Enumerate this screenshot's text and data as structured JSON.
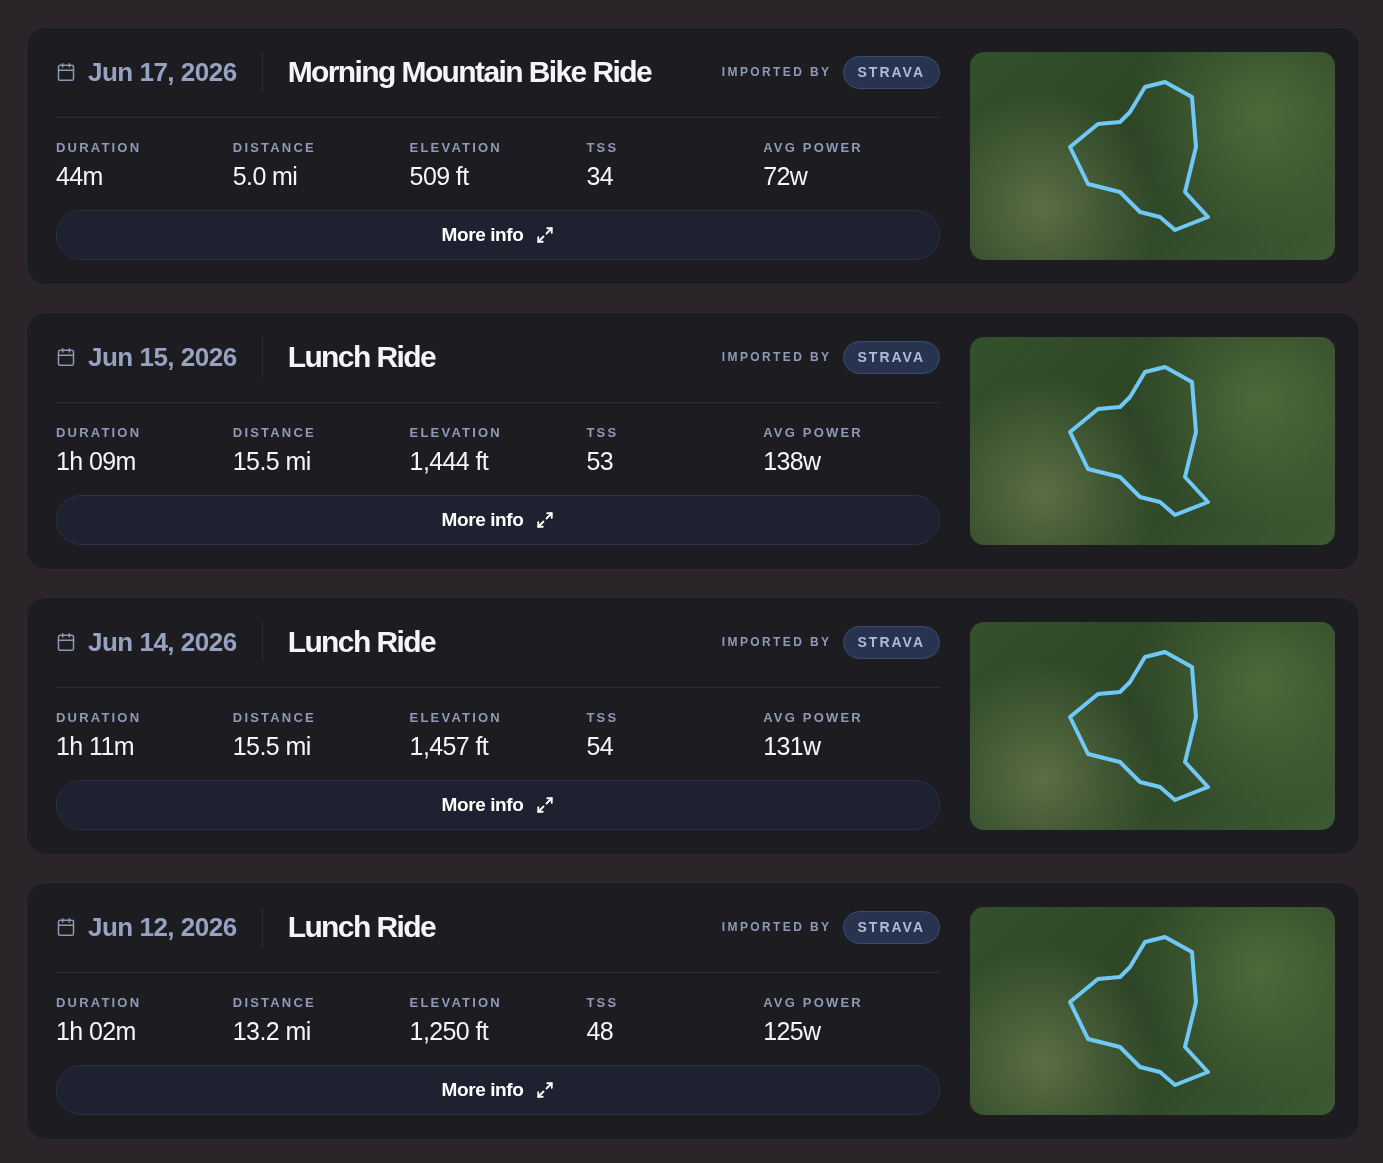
{
  "activities": [
    {
      "date": "Jun 17, 2026",
      "title": "Morning Mountain Bike Ride",
      "imported_by": "IMPORTED BY",
      "source": "STRAVA",
      "stats": [
        {
          "label": "DURATION",
          "value": "44m"
        },
        {
          "label": "DISTANCE",
          "value": "5.0 mi"
        },
        {
          "label": "ELEVATION",
          "value": "509 ft"
        },
        {
          "label": "TSS",
          "value": "34"
        },
        {
          "label": "AVG POWER",
          "value": "72w"
        }
      ],
      "button": "More info"
    },
    {
      "date": "Jun 15, 2026",
      "title": "Lunch Ride",
      "imported_by": "IMPORTED BY",
      "source": "STRAVA",
      "stats": [
        {
          "label": "DURATION",
          "value": "1h 09m"
        },
        {
          "label": "DISTANCE",
          "value": "15.5 mi"
        },
        {
          "label": "ELEVATION",
          "value": "1,444 ft"
        },
        {
          "label": "TSS",
          "value": "53"
        },
        {
          "label": "AVG POWER",
          "value": "138w"
        }
      ],
      "button": "More info"
    },
    {
      "date": "Jun 14, 2026",
      "title": "Lunch Ride",
      "imported_by": "IMPORTED BY",
      "source": "STRAVA",
      "stats": [
        {
          "label": "DURATION",
          "value": "1h 11m"
        },
        {
          "label": "DISTANCE",
          "value": "15.5 mi"
        },
        {
          "label": "ELEVATION",
          "value": "1,457 ft"
        },
        {
          "label": "TSS",
          "value": "54"
        },
        {
          "label": "AVG POWER",
          "value": "131w"
        }
      ],
      "button": "More info"
    },
    {
      "date": "Jun 12, 2026",
      "title": "Lunch Ride",
      "imported_by": "IMPORTED BY",
      "source": "STRAVA",
      "stats": [
        {
          "label": "DURATION",
          "value": "1h 02m"
        },
        {
          "label": "DISTANCE",
          "value": "13.2 mi"
        },
        {
          "label": "ELEVATION",
          "value": "1,250 ft"
        },
        {
          "label": "TSS",
          "value": "48"
        },
        {
          "label": "AVG POWER",
          "value": "125w"
        }
      ],
      "button": "More info"
    }
  ]
}
